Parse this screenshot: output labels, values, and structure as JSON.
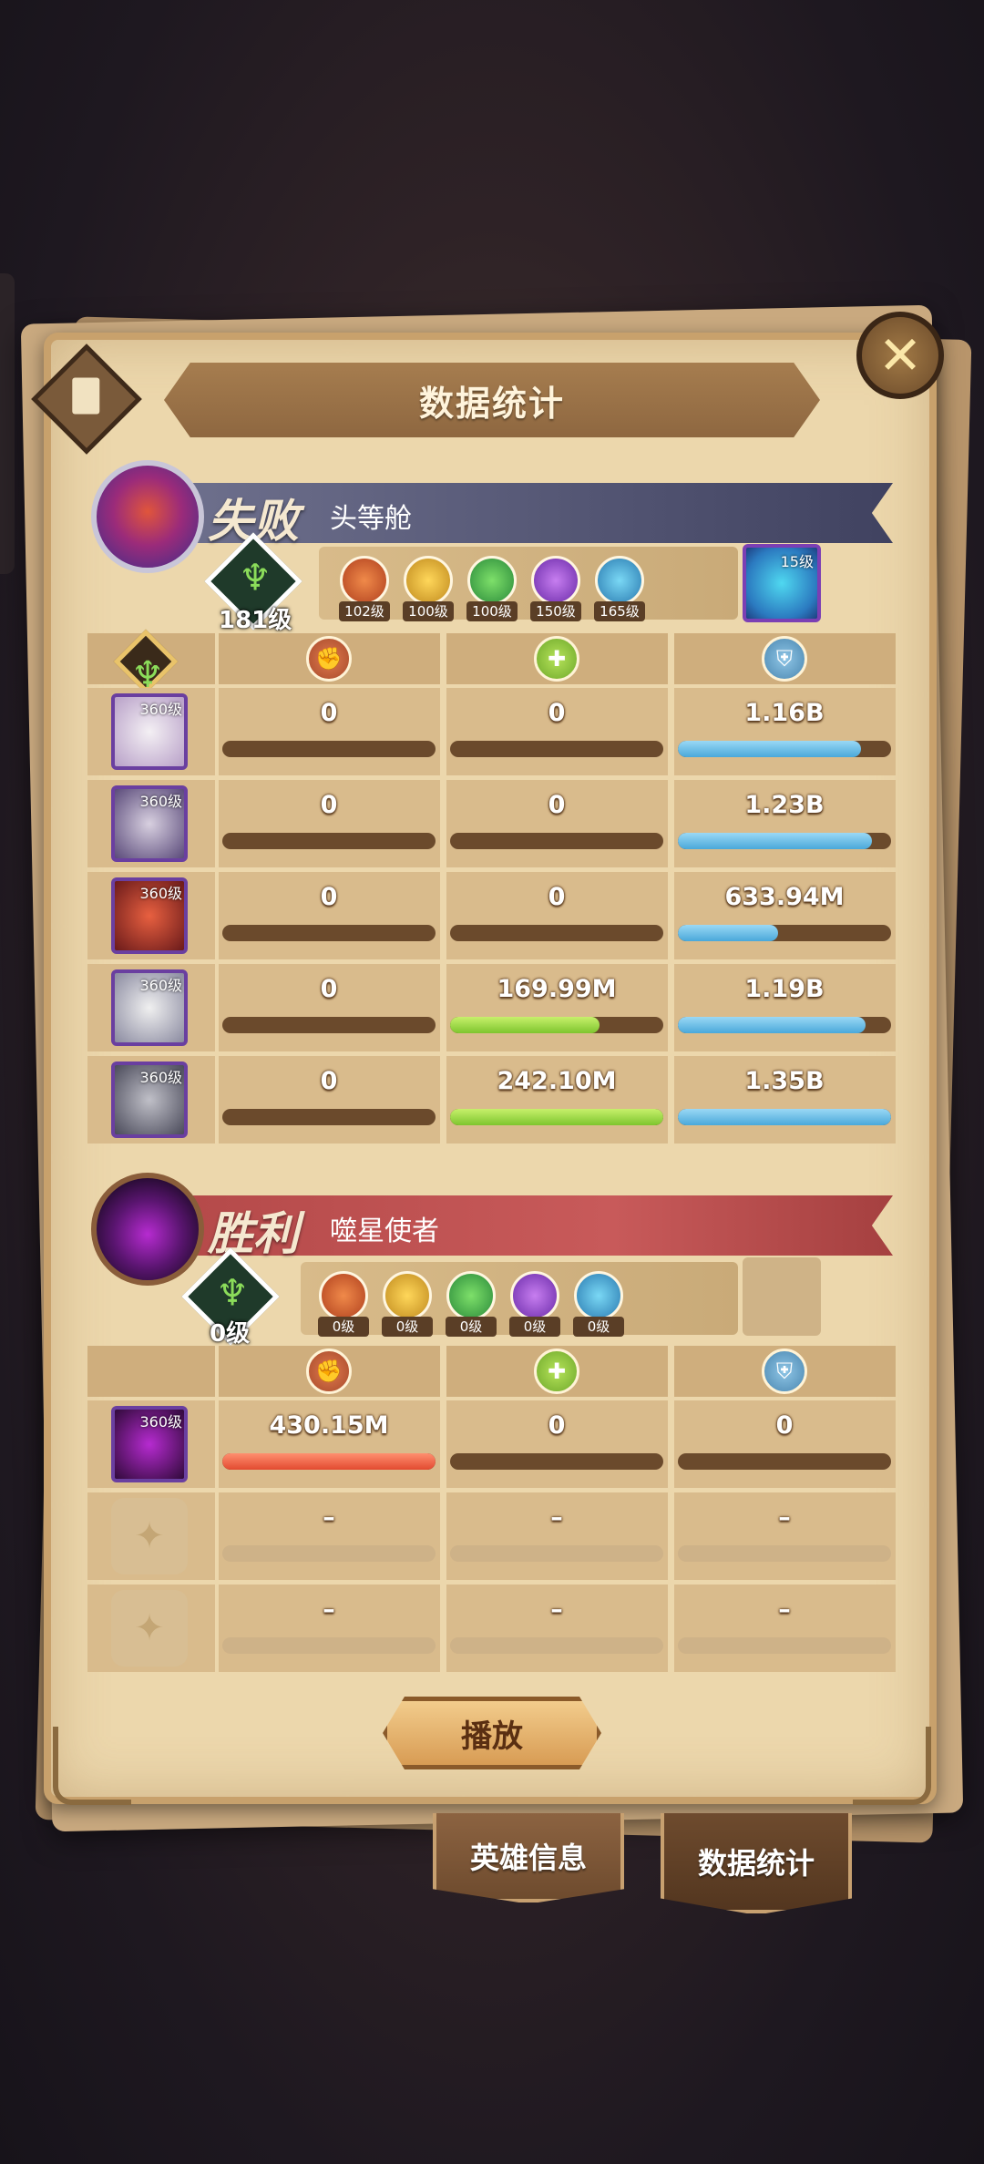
{
  "title": "数据统计",
  "close_icon": "close-x-icon",
  "teams": [
    {
      "status": "失败",
      "name": "头等舱",
      "level": "181级",
      "faction_levels": [
        "102级",
        "100级",
        "100级",
        "150级",
        "165级"
      ],
      "pet_level": "15级",
      "heroes": [
        {
          "level": "360级",
          "damage": "0",
          "heal": "0",
          "tank": "1.16B",
          "damage_frac": 0,
          "heal_frac": 0,
          "tank_frac": 0.86
        },
        {
          "level": "360级",
          "damage": "0",
          "heal": "0",
          "tank": "1.23B",
          "damage_frac": 0,
          "heal_frac": 0,
          "tank_frac": 0.91
        },
        {
          "level": "360级",
          "damage": "0",
          "heal": "0",
          "tank": "633.94M",
          "damage_frac": 0,
          "heal_frac": 0,
          "tank_frac": 0.47
        },
        {
          "level": "360级",
          "damage": "0",
          "heal": "169.99M",
          "tank": "1.19B",
          "damage_frac": 0,
          "heal_frac": 0.7,
          "tank_frac": 0.88
        },
        {
          "level": "360级",
          "damage": "0",
          "heal": "242.10M",
          "tank": "1.35B",
          "damage_frac": 0,
          "heal_frac": 1.0,
          "tank_frac": 1.0
        }
      ]
    },
    {
      "status": "胜利",
      "name": "噬星使者",
      "level": "0级",
      "faction_levels": [
        "0级",
        "0级",
        "0级",
        "0级",
        "0级"
      ],
      "heroes": [
        {
          "level": "360级",
          "damage": "430.15M",
          "heal": "0",
          "tank": "0",
          "damage_frac": 1.0,
          "heal_frac": 0,
          "tank_frac": 0
        },
        {
          "empty": true,
          "damage": "–",
          "heal": "–",
          "tank": "–"
        },
        {
          "empty": true,
          "damage": "–",
          "heal": "–",
          "tank": "–"
        }
      ]
    }
  ],
  "play_label": "播放",
  "tabs": [
    "英雄信息",
    "数据统计"
  ],
  "colors": {
    "damage": "#e24a30",
    "heal": "#7ec52e",
    "tank": "#4aa8da",
    "parchment": "#ecd7ac"
  }
}
